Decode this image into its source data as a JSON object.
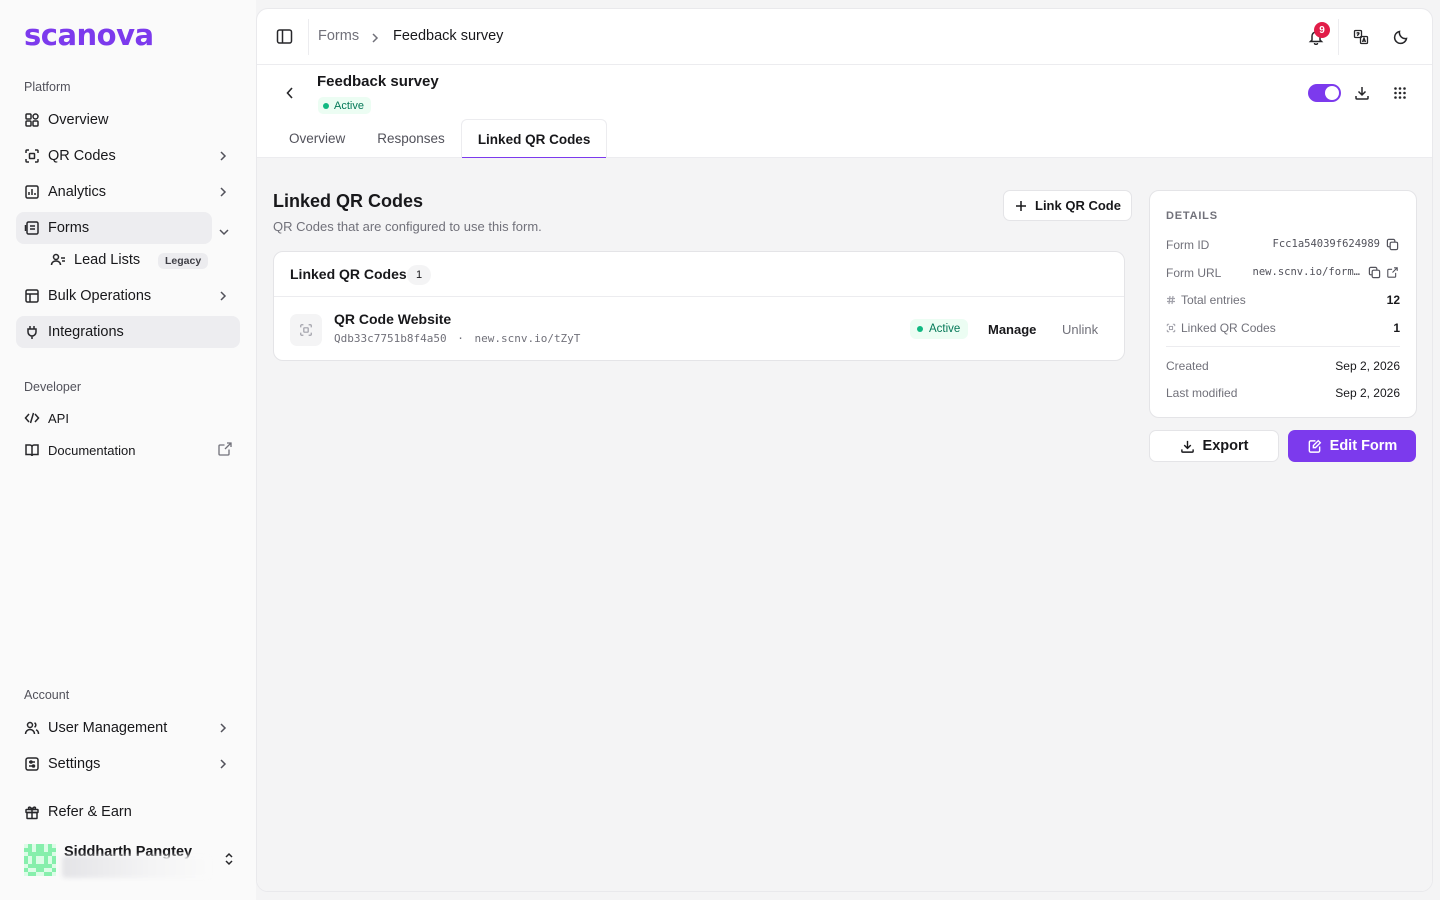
{
  "brand": {
    "logo_text": "scanova",
    "accent": "#7c3aed"
  },
  "sidebar": {
    "platform_label": "Platform",
    "items": [
      {
        "label": "Overview",
        "icon": "layout-grid-icon"
      },
      {
        "label": "QR Codes",
        "icon": "scan-icon"
      },
      {
        "label": "Analytics",
        "icon": "bar-chart-icon"
      },
      {
        "label": "Forms",
        "icon": "form-icon"
      },
      {
        "label": "Lead Lists",
        "icon": "user-list-icon",
        "badge": "Legacy"
      },
      {
        "label": "Bulk Operations",
        "icon": "layers-icon"
      },
      {
        "label": "Integrations",
        "icon": "plug-icon"
      }
    ],
    "developer_label": "Developer",
    "dev_items": [
      {
        "label": "API",
        "icon": "code-icon"
      },
      {
        "label": "Documentation",
        "icon": "book-icon"
      }
    ],
    "account_label": "Account",
    "account_items": [
      {
        "label": "User Management",
        "icon": "users-icon"
      },
      {
        "label": "Settings",
        "icon": "settings-icon"
      },
      {
        "label": "Refer & Earn",
        "icon": "gift-icon"
      }
    ],
    "user": {
      "name": "Siddharth Pangtey"
    }
  },
  "topbar": {
    "breadcrumb_root": "Forms",
    "breadcrumb_current": "Feedback survey",
    "notification_count": "9"
  },
  "header": {
    "title": "Feedback survey",
    "status": "Active",
    "tabs": [
      "Overview",
      "Responses",
      "Linked QR Codes"
    ],
    "active_tab": "Linked QR Codes"
  },
  "linked": {
    "title": "Linked QR Codes",
    "subtitle": "QR Codes that are configured to use this form.",
    "link_button": "Link QR Code",
    "card_title": "Linked QR Codes",
    "count": "1",
    "rows": [
      {
        "name": "QR Code Website",
        "id": "Qdb33c7751b8f4a50",
        "separator": "·",
        "url": "new.scnv.io/tZyT",
        "status": "Active",
        "manage": "Manage",
        "unlink": "Unlink"
      }
    ]
  },
  "details": {
    "heading": "DETAILS",
    "form_id_label": "Form ID",
    "form_id": "Fcc1a54039f624989",
    "form_url_label": "Form URL",
    "form_url": "new.scnv.io/form…",
    "total_entries_label": "Total entries",
    "total_entries": "12",
    "linked_label": "Linked QR Codes",
    "linked_count": "1",
    "created_label": "Created",
    "created": "Sep 2, 2026",
    "modified_label": "Last modified",
    "modified": "Sep 2, 2026"
  },
  "actions": {
    "export": "Export",
    "edit": "Edit Form"
  }
}
